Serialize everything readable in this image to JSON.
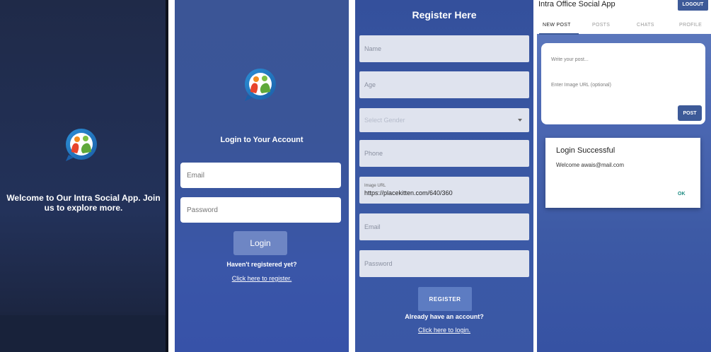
{
  "splash": {
    "logo": "app-logo-icon",
    "welcome_text": "Welcome to Our Intra Social App. Join us to explore more."
  },
  "login": {
    "logo": "app-logo-icon",
    "title": "Login to Your Account",
    "email_placeholder": "Email",
    "password_placeholder": "Password",
    "login_button": "Login",
    "not_registered": "Haven't registered yet?",
    "register_link": "Click here to register."
  },
  "register": {
    "title": "Register Here",
    "fields": {
      "name": "Name",
      "age": "Age",
      "gender": "Select Gender",
      "phone": "Phone",
      "image_label": "Image URL",
      "image_value": "https://placekitten.com/640/360",
      "email": "Email",
      "password": "Password"
    },
    "register_button": "REGISTER",
    "have_account": "Already have an account?",
    "login_link": "Click here to login."
  },
  "app": {
    "title": "Intra Office Social App",
    "logout_button": "LOGOUT",
    "tabs": [
      {
        "label": "NEW POST",
        "active": true
      },
      {
        "label": "POSTS",
        "active": false
      },
      {
        "label": "CHATS",
        "active": false
      },
      {
        "label": "PROFILE",
        "active": false
      }
    ],
    "post_placeholder": "Write your post...",
    "image_placeholder": "Enter Image URL (optional)",
    "post_button": "POST",
    "dialog": {
      "title": "Login Successful",
      "message": "Welcome awais@mail.com",
      "ok": "OK"
    }
  },
  "colors": {
    "primary": "#3d5a98",
    "splash_bg": "#1f2a48",
    "panel_blue": "#3a56a8",
    "ok_text": "#1a8a80"
  }
}
